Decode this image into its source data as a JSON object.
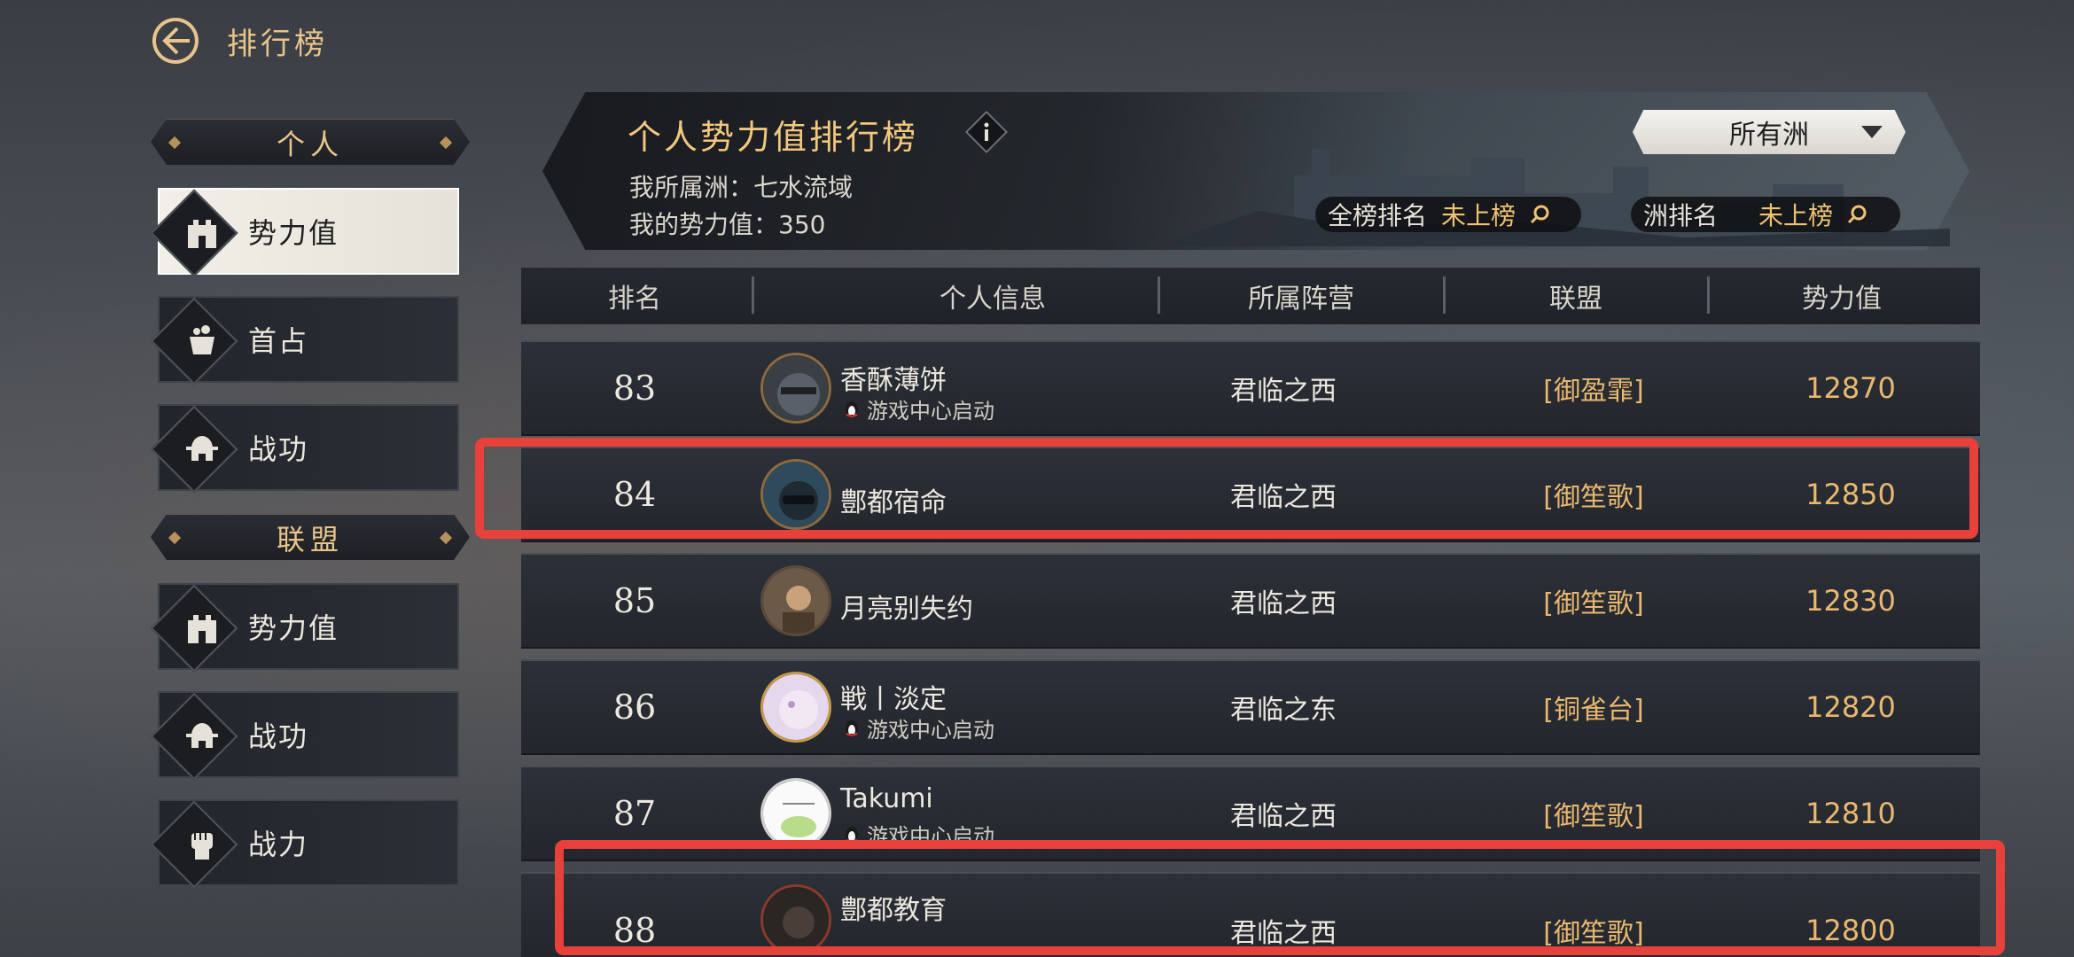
{
  "header": {
    "title": "排行榜"
  },
  "sidebar": {
    "sections": [
      {
        "label": "个人",
        "items": [
          {
            "label": "势力值",
            "icon": "castle-icon",
            "active": true
          },
          {
            "label": "首占",
            "icon": "cauldron-icon",
            "active": false
          },
          {
            "label": "战功",
            "icon": "helmet-icon",
            "active": false
          }
        ]
      },
      {
        "label": "联盟",
        "items": [
          {
            "label": "势力值",
            "icon": "castle-icon",
            "active": false
          },
          {
            "label": "战功",
            "icon": "helmet-icon",
            "active": false
          },
          {
            "label": "战力",
            "icon": "fist-icon",
            "active": false
          }
        ]
      }
    ]
  },
  "banner": {
    "title": "个人势力值排行榜",
    "region_line": "我所属洲：七水流域",
    "power_line": "我的势力值：350",
    "region_select": "所有洲",
    "global_rank_label": "全榜排名",
    "global_rank_value": "未上榜",
    "region_rank_label": "洲排名",
    "region_rank_value": "未上榜"
  },
  "table": {
    "headers": [
      "排名",
      "个人信息",
      "所属阵营",
      "联盟",
      "势力值"
    ],
    "rows": [
      {
        "rank": "83",
        "name": "香酥薄饼",
        "sub": "游戏中心启动",
        "camp": "君临之西",
        "alliance": "[御盈霏]",
        "power": "12870"
      },
      {
        "rank": "84",
        "name": "鄷都宿命",
        "sub": "",
        "camp": "君临之西",
        "alliance": "[御笙歌]",
        "power": "12850"
      },
      {
        "rank": "85",
        "name": "月亮别失约",
        "sub": "",
        "camp": "君临之西",
        "alliance": "[御笙歌]",
        "power": "12830"
      },
      {
        "rank": "86",
        "name": "戦丨淡定",
        "sub": "游戏中心启动",
        "camp": "君临之东",
        "alliance": "[铜雀台]",
        "power": "12820"
      },
      {
        "rank": "87",
        "name": "Takumi",
        "sub": "游戏中心启动",
        "camp": "君临之西",
        "alliance": "[御笙歌]",
        "power": "12810"
      },
      {
        "rank": "88",
        "name": "鄷都教育",
        "sub": "",
        "camp": "君临之西",
        "alliance": "[御笙歌]",
        "power": "12800"
      }
    ]
  },
  "colors": {
    "gold": "#e9b870",
    "highlight": "#e8413b"
  }
}
